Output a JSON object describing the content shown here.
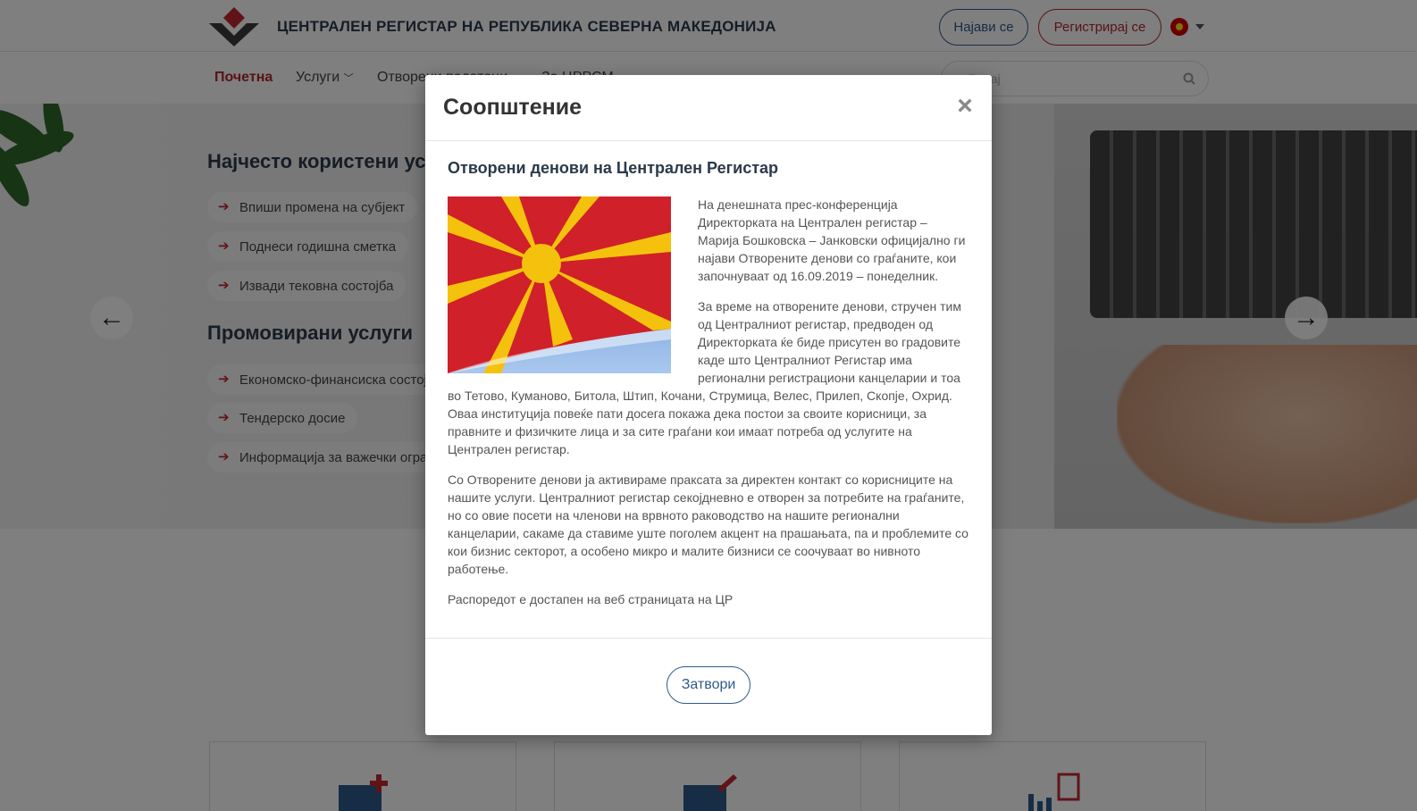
{
  "header": {
    "site_title": "ЦЕНТРАЛЕН РЕГИСТАР НА РЕПУБЛИКА СЕВЕРНА МАКЕДОНИЈА",
    "login_label": "Најави се",
    "register_label": "Регистрирај се",
    "language_icon": "mk-flag-icon"
  },
  "nav": {
    "items": [
      {
        "label": "Почетна",
        "active": true
      },
      {
        "label": "Услуги"
      },
      {
        "label": "Отворени податоци"
      },
      {
        "label": "За ЦРРСМ"
      }
    ],
    "search_placeholder": "Барај"
  },
  "hero": {
    "frequent_title": "Најчесто користени услуги",
    "frequent_items": [
      "Впиши промена на субјект",
      "Поднеси годишна сметка",
      "Извади тековна состојба"
    ],
    "promoted_title": "Промовирани услуги",
    "promoted_items": [
      "Економско-финансиска состојба",
      "Тендерско досие",
      "Информација за важечки ограничувања"
    ]
  },
  "modal": {
    "title": "Соопштение",
    "close_symbol": "×",
    "article_title": "Отворени денови на Централен Регистар",
    "paragraphs": [
      "На денешната прес-конференција Директорката на Централен регистар – Марија Бошковска – Јанковски официјално ги најави Отворените денови со граѓаните, кои започнуваат од 16.09.2019 – понеделник.",
      "За време на отворените денови, стручен тим од Централниот регистар, предводен од Директорката ќе биде присутен во градовите каде што Централниот Регистар има регионални регистрациони канцеларии и тоа во Тетово, Куманово, Битола, Штип, Кочани, Струмица, Велес, Прилеп, Скопје, Охрид. Оваа институција повеќе пати досега покажа дека постои за своите корисници, за правните и физичките лица и за сите граѓани кои имаат потреба од услугите на Централен регистар.",
      "Со Отворените денови ја активираме праксата за директен контакт со корисниците на нашите услуги. Централниот регистар секојдневно е отворен за потребите на граѓаните, но со овие посети на членови на врвното раководство на нашите регионални канцеларии, сакаме да ставиме уште поголем акцент на прашањата, па и проблемите со кои бизнис секторот, а особено микро и малите бизниси се соочуваат во нивното работење.",
      "Распоредот е достапен на веб страницата на ЦР"
    ],
    "close_button_label": "Затвори"
  },
  "colors": {
    "brand_red": "#b3262b",
    "brand_blue": "#2d5b8a",
    "overlay": "rgba(0,0,0,0.5)"
  }
}
